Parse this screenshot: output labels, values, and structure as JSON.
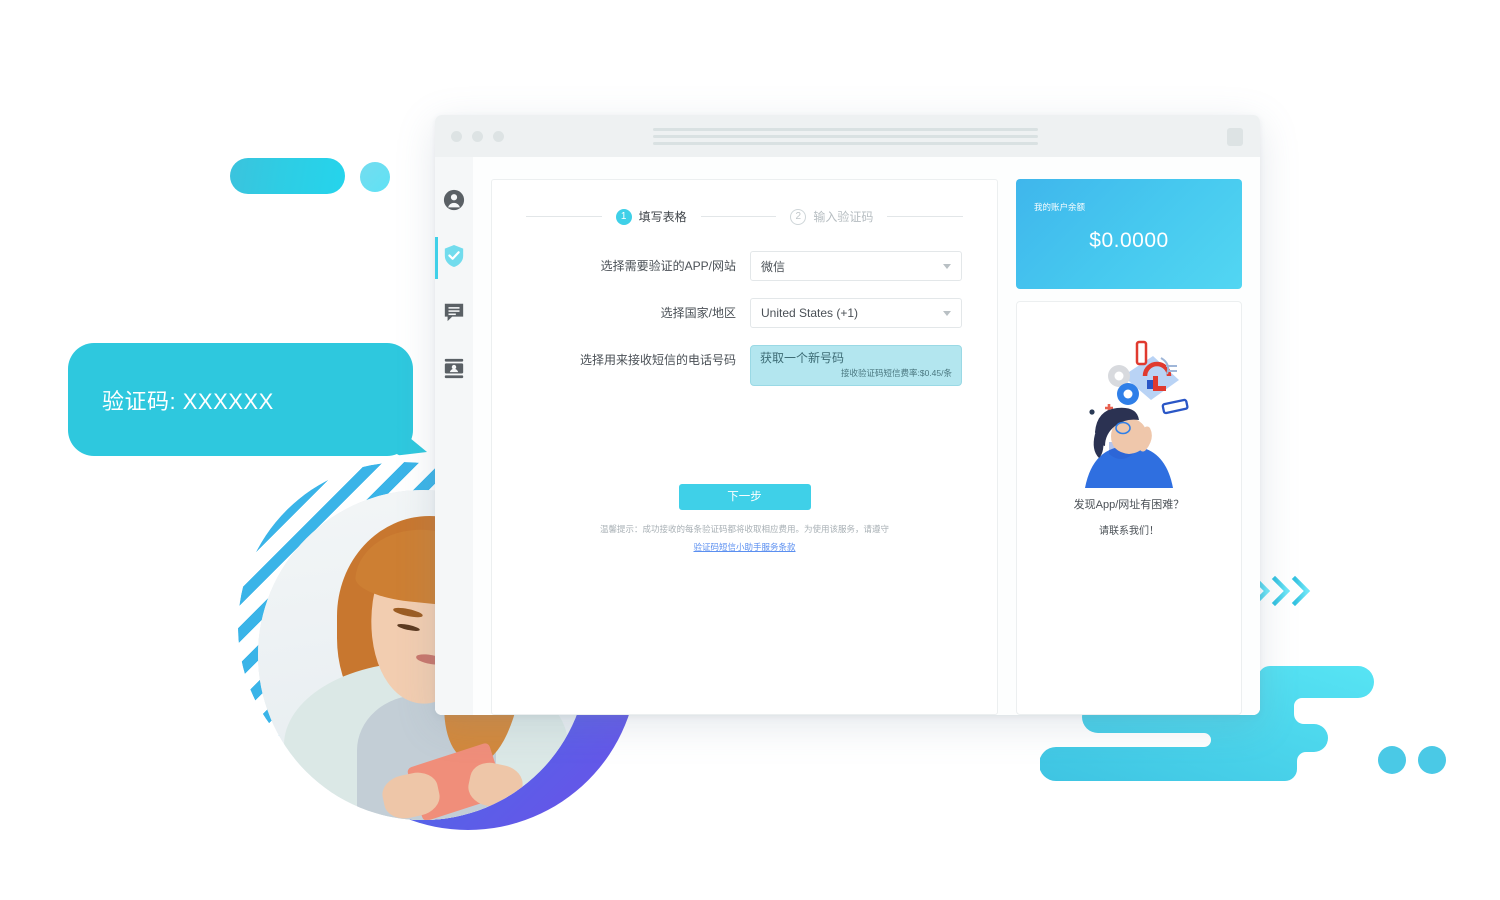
{
  "decor": {
    "speech_bubble_text": "验证码: XXXXXX",
    "accent_cyan": "#3fd0e8",
    "accent_blue": "#3fb6ec",
    "accent_purple": "#6d4fe8",
    "chevron_count": 11
  },
  "browser": {
    "dots": [
      "window-dot-red",
      "window-dot-yellow",
      "window-dot-green"
    ],
    "address_placeholder_lines": 3
  },
  "sidebar": {
    "items": [
      {
        "icon": "user-circle-icon",
        "name": "sidebar-item-account",
        "active": false
      },
      {
        "icon": "shield-check-icon",
        "name": "sidebar-item-verification",
        "active": true
      },
      {
        "icon": "message-lines-icon",
        "name": "sidebar-item-messages",
        "active": false
      },
      {
        "icon": "contact-card-icon",
        "name": "sidebar-item-contacts",
        "active": false
      }
    ]
  },
  "stepper": {
    "steps": [
      {
        "num": "1",
        "label": "填写表格",
        "active": true
      },
      {
        "num": "2",
        "label": "输入验证码",
        "active": false
      }
    ]
  },
  "form": {
    "rows": [
      {
        "label": "选择需要验证的APP/网站",
        "value": "微信",
        "type": "select",
        "name": "app-website-select"
      },
      {
        "label": "选择国家/地区",
        "value": "United States (+1)",
        "type": "select",
        "name": "country-region-select"
      }
    ],
    "phone_row": {
      "label": "选择用来接收短信的电话号码",
      "value": "获取一个新号码",
      "rate": "接收验证码短信费率:$0.45/条"
    },
    "next_button": "下一步",
    "footnote": "温馨提示：成功接收的每条验证码都将收取相应费用。为使用该服务，请遵守",
    "footnote_link": "验证码短信小助手服务条款"
  },
  "balance": {
    "label": "我的账户余额",
    "amount": "$0.0000"
  },
  "help": {
    "title": "发现App/网址有困难？",
    "subtitle": "请联系我们！",
    "illustration": "person-thinking-lock-gear-illustration"
  }
}
